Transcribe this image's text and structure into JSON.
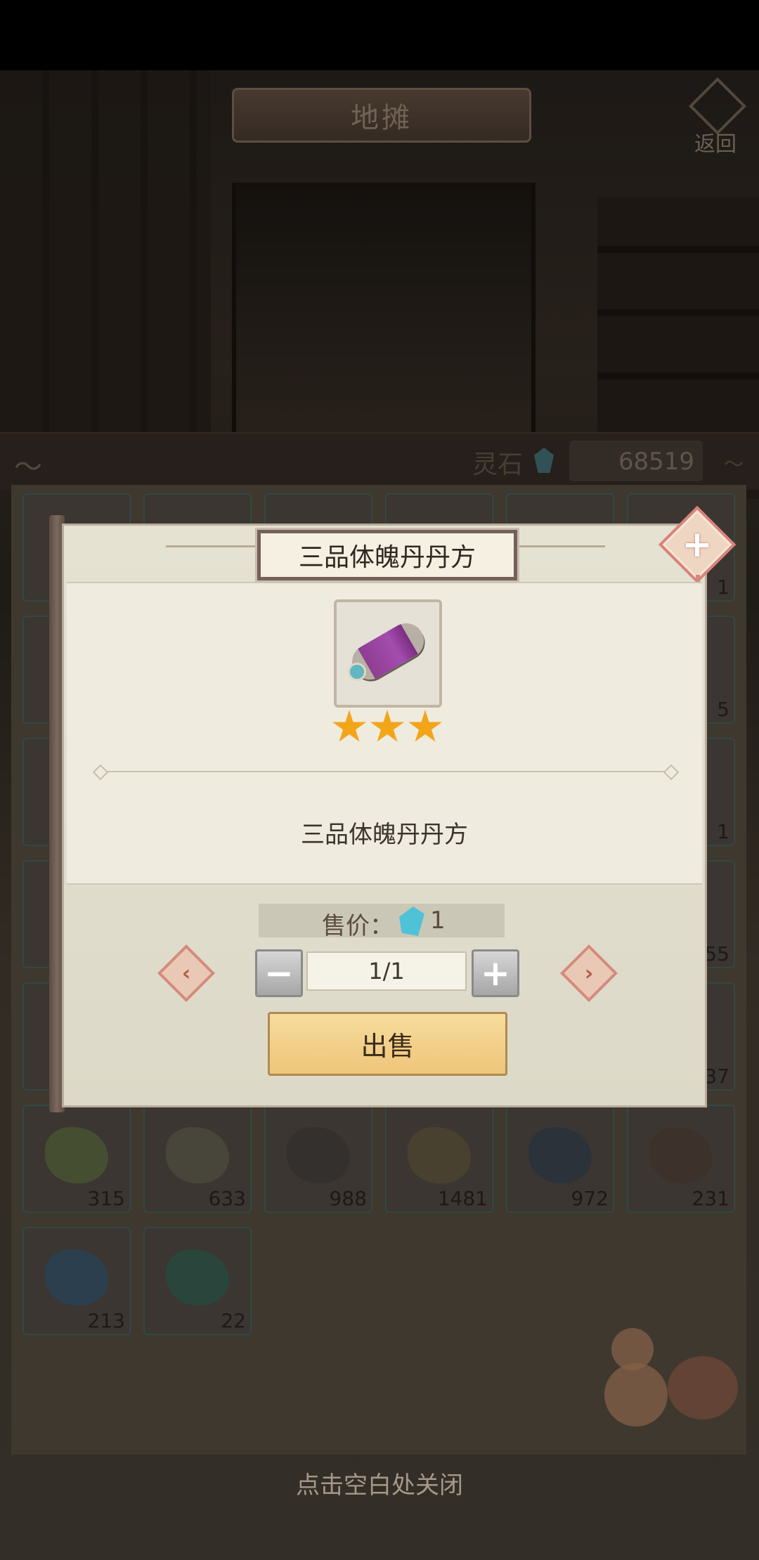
{
  "shop": {
    "title": "地摊",
    "back_label": "返回"
  },
  "currency": {
    "label": "灵石",
    "value": "68519"
  },
  "inventory": {
    "counts_visible": [
      "1",
      "5",
      "1",
      "55",
      "37"
    ],
    "row6": [
      {
        "count": "315",
        "color": "#6b7a4a"
      },
      {
        "count": "633",
        "color": "#6f6a58"
      },
      {
        "count": "988",
        "color": "#4a4642"
      },
      {
        "count": "1481",
        "color": "#6e6448"
      },
      {
        "count": "972",
        "color": "#3e4a58"
      },
      {
        "count": "231",
        "color": "#5a4a3e"
      }
    ],
    "row7": [
      {
        "count": "213",
        "color": "#3d5f7a"
      },
      {
        "count": "22",
        "color": "#3a6a5a"
      }
    ]
  },
  "dialog": {
    "title": "三品体魄丹丹方",
    "stars": 3,
    "description": "三品体魄丹丹方",
    "price_label": "售价：",
    "price_value": "1",
    "quantity": "1/1",
    "sell_label": "出售",
    "minus_glyph": "−",
    "plus_glyph": "+",
    "prev_glyph": "‹",
    "next_glyph": "›"
  },
  "footer": {
    "close_hint": "点击空白处关闭"
  },
  "colors": {
    "star": "#f3a51a",
    "sell_button": "#f1cd86",
    "gem": "#4fc2d8"
  }
}
